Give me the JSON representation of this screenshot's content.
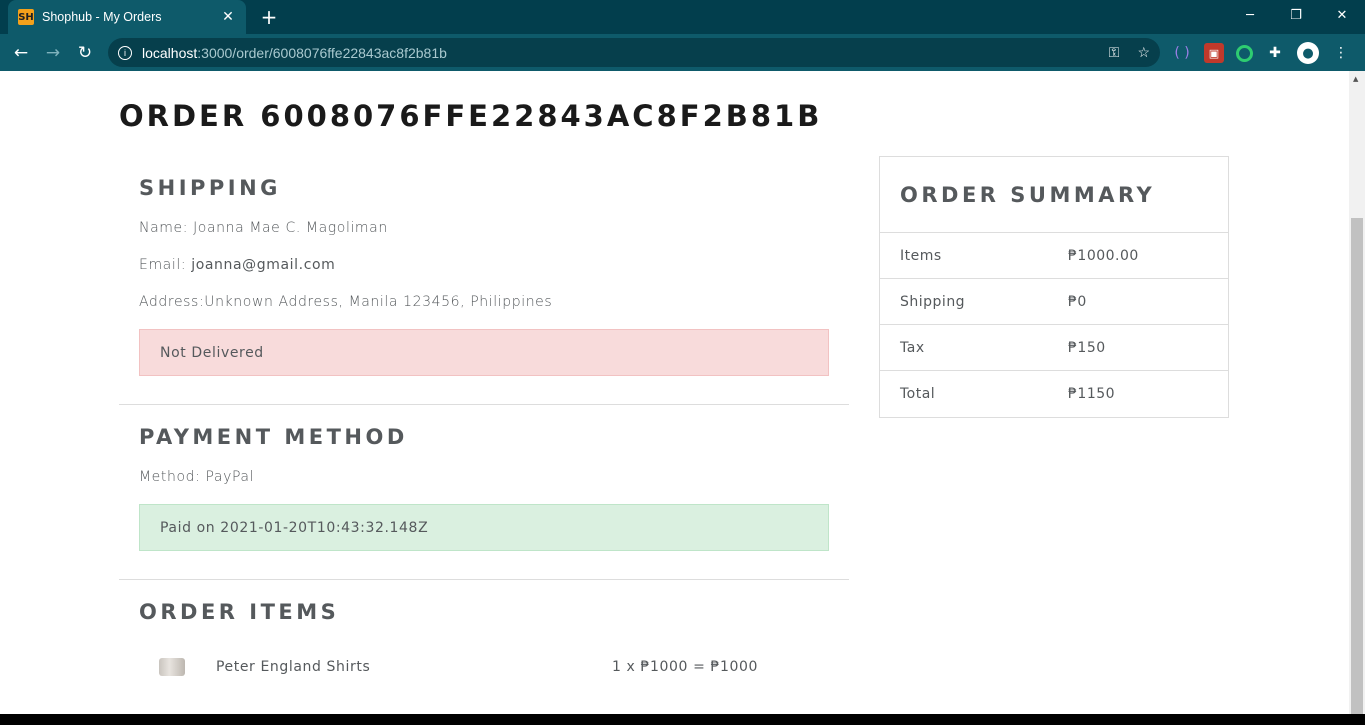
{
  "browser": {
    "tab_title": "Shophub - My Orders",
    "favicon_text": "SH",
    "new_tab_symbol": "+",
    "url_host": "localhost",
    "url_path": ":3000/order/6008076ffe22843ac8f2b81b"
  },
  "order": {
    "title": "ORDER 6008076FFE22843AC8F2B81B"
  },
  "shipping": {
    "heading": "SHIPPING",
    "name_label": "Name: ",
    "name": "Joanna Mae C. Magoliman",
    "email_label": "Email: ",
    "email": "joanna@gmail.com",
    "address_label": "Address:",
    "address": "Unknown Address, Manila 123456, Philippines",
    "status": "Not Delivered"
  },
  "payment": {
    "heading": "PAYMENT METHOD",
    "method_label": "Method: ",
    "method": "PayPal",
    "status": "Paid on 2021-01-20T10:43:32.148Z"
  },
  "items": {
    "heading": "ORDER ITEMS",
    "list": [
      {
        "name": "Peter England Shirts",
        "calc": "1 x ₱1000 = ₱1000"
      }
    ]
  },
  "summary": {
    "heading": "ORDER SUMMARY",
    "rows": [
      {
        "label": "Items",
        "value": "₱1000.00"
      },
      {
        "label": "Shipping",
        "value": "₱0"
      },
      {
        "label": "Tax",
        "value": "₱150"
      },
      {
        "label": "Total",
        "value": "₱1150"
      }
    ]
  }
}
